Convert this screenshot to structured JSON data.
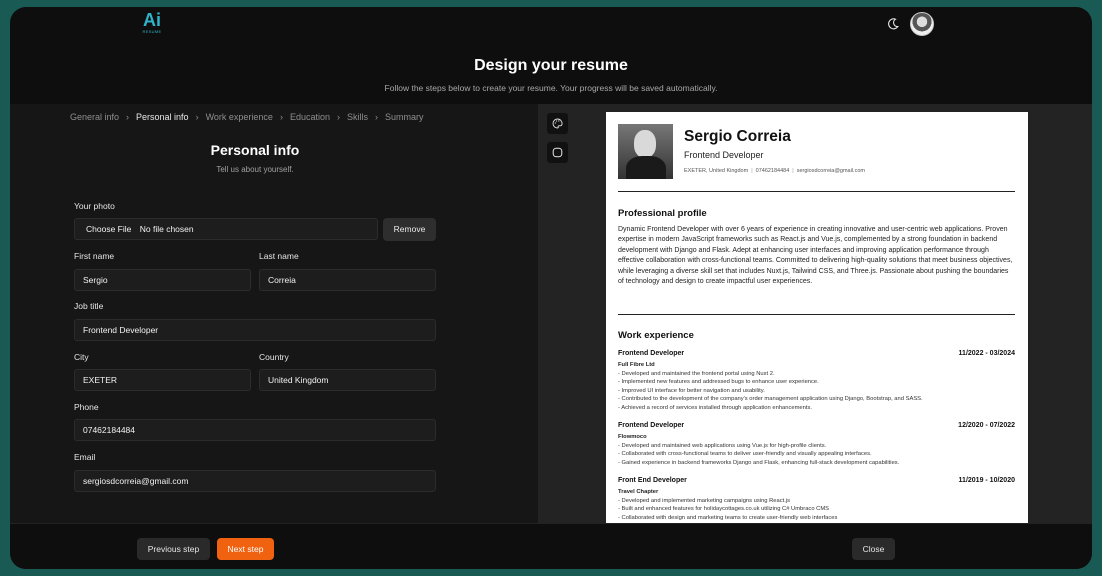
{
  "logo": {
    "mark": "Ai",
    "sub": "RESUME"
  },
  "header": {
    "title": "Design your resume",
    "subtitle": "Follow the steps below to create your resume. Your progress will be saved automatically."
  },
  "steps": [
    "General info",
    "Personal info",
    "Work experience",
    "Education",
    "Skills",
    "Summary"
  ],
  "form": {
    "title": "Personal info",
    "subtitle": "Tell us about yourself.",
    "photo_label": "Your photo",
    "choose_file": "Choose File",
    "no_file": "No file chosen",
    "remove": "Remove",
    "first_name_label": "First name",
    "first_name": "Sergio",
    "last_name_label": "Last name",
    "last_name": "Correia",
    "job_title_label": "Job title",
    "job_title": "Frontend Developer",
    "city_label": "City",
    "city": "EXETER",
    "country_label": "Country",
    "country": "United Kingdom",
    "phone_label": "Phone",
    "phone": "07462184484",
    "email_label": "Email",
    "email": "sergiosdcorreia@gmail.com"
  },
  "footer": {
    "prev": "Previous step",
    "next": "Next step",
    "close": "Close"
  },
  "resume": {
    "name": "Sergio Correia",
    "title": "Frontend Developer",
    "location": "EXETER, United Kingdom",
    "phone": "07462184484",
    "email": "sergiosdcorreia@gmail.com",
    "profile_heading": "Professional profile",
    "profile": "Dynamic Frontend Developer with over 6 years of experience in creating innovative and user-centric web applications. Proven expertise in modern JavaScript frameworks such as React.js and Vue.js, complemented by a strong foundation in backend development with Django and Flask. Adept at enhancing user interfaces and improving application performance through effective collaboration with cross-functional teams. Committed to delivering high-quality solutions that meet business objectives, while leveraging a diverse skill set that includes Nuxt.js, Tailwind CSS, and Three.js. Passionate about pushing the boundaries of technology and design to create impactful user experiences.",
    "work_heading": "Work experience",
    "jobs": [
      {
        "title": "Frontend Developer",
        "dates": "11/2022 - 03/2024",
        "company": "Full Fibre Ltd",
        "points": "- Developed and maintained the frontend portal using Nuxt 2.\n- Implemented new features and addressed bugs to enhance user experience.\n- Improved UI interface for better navigation and usability.\n- Contributed to the development of the company's order management application using Django, Bootstrap, and SASS.\n- Achieved a record of services installed through application enhancements."
      },
      {
        "title": "Frontend Developer",
        "dates": "12/2020 - 07/2022",
        "company": "Flowmoco",
        "points": "- Developed and maintained web applications using Vue.js for high-profile clients.\n- Collaborated with cross-functional teams to deliver user-friendly and visually appealing interfaces.\n- Gained experience in backend frameworks Django and Flask, enhancing full-stack development capabilities."
      },
      {
        "title": "Front End Developer",
        "dates": "11/2019 - 10/2020",
        "company": "Travel Chapter",
        "points": "- Developed and implemented marketing campaigns using React.js\n- Built and enhanced features for holidaycottages.co.uk utilizing C# Umbraco CMS\n- Collaborated with design and marketing teams to create user-friendly web interfaces"
      }
    ]
  },
  "icons": {
    "theme": "moon-icon",
    "palette": "palette-icon",
    "shape": "circle-icon"
  },
  "colors": {
    "accent": "#f0620f",
    "brand": "#2fb3c9",
    "frame": "#1a5a55"
  }
}
